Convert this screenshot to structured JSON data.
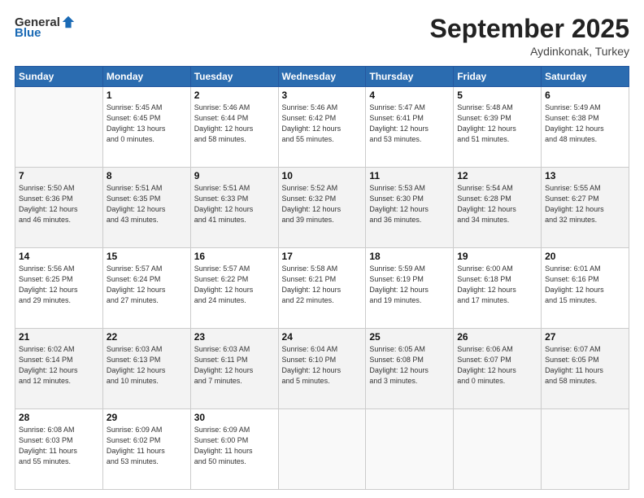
{
  "header": {
    "logo_general": "General",
    "logo_blue": "Blue",
    "month": "September 2025",
    "location": "Aydinkonak, Turkey"
  },
  "days_of_week": [
    "Sunday",
    "Monday",
    "Tuesday",
    "Wednesday",
    "Thursday",
    "Friday",
    "Saturday"
  ],
  "weeks": [
    [
      {
        "num": "",
        "info": ""
      },
      {
        "num": "1",
        "info": "Sunrise: 5:45 AM\nSunset: 6:45 PM\nDaylight: 13 hours\nand 0 minutes."
      },
      {
        "num": "2",
        "info": "Sunrise: 5:46 AM\nSunset: 6:44 PM\nDaylight: 12 hours\nand 58 minutes."
      },
      {
        "num": "3",
        "info": "Sunrise: 5:46 AM\nSunset: 6:42 PM\nDaylight: 12 hours\nand 55 minutes."
      },
      {
        "num": "4",
        "info": "Sunrise: 5:47 AM\nSunset: 6:41 PM\nDaylight: 12 hours\nand 53 minutes."
      },
      {
        "num": "5",
        "info": "Sunrise: 5:48 AM\nSunset: 6:39 PM\nDaylight: 12 hours\nand 51 minutes."
      },
      {
        "num": "6",
        "info": "Sunrise: 5:49 AM\nSunset: 6:38 PM\nDaylight: 12 hours\nand 48 minutes."
      }
    ],
    [
      {
        "num": "7",
        "info": "Sunrise: 5:50 AM\nSunset: 6:36 PM\nDaylight: 12 hours\nand 46 minutes."
      },
      {
        "num": "8",
        "info": "Sunrise: 5:51 AM\nSunset: 6:35 PM\nDaylight: 12 hours\nand 43 minutes."
      },
      {
        "num": "9",
        "info": "Sunrise: 5:51 AM\nSunset: 6:33 PM\nDaylight: 12 hours\nand 41 minutes."
      },
      {
        "num": "10",
        "info": "Sunrise: 5:52 AM\nSunset: 6:32 PM\nDaylight: 12 hours\nand 39 minutes."
      },
      {
        "num": "11",
        "info": "Sunrise: 5:53 AM\nSunset: 6:30 PM\nDaylight: 12 hours\nand 36 minutes."
      },
      {
        "num": "12",
        "info": "Sunrise: 5:54 AM\nSunset: 6:28 PM\nDaylight: 12 hours\nand 34 minutes."
      },
      {
        "num": "13",
        "info": "Sunrise: 5:55 AM\nSunset: 6:27 PM\nDaylight: 12 hours\nand 32 minutes."
      }
    ],
    [
      {
        "num": "14",
        "info": "Sunrise: 5:56 AM\nSunset: 6:25 PM\nDaylight: 12 hours\nand 29 minutes."
      },
      {
        "num": "15",
        "info": "Sunrise: 5:57 AM\nSunset: 6:24 PM\nDaylight: 12 hours\nand 27 minutes."
      },
      {
        "num": "16",
        "info": "Sunrise: 5:57 AM\nSunset: 6:22 PM\nDaylight: 12 hours\nand 24 minutes."
      },
      {
        "num": "17",
        "info": "Sunrise: 5:58 AM\nSunset: 6:21 PM\nDaylight: 12 hours\nand 22 minutes."
      },
      {
        "num": "18",
        "info": "Sunrise: 5:59 AM\nSunset: 6:19 PM\nDaylight: 12 hours\nand 19 minutes."
      },
      {
        "num": "19",
        "info": "Sunrise: 6:00 AM\nSunset: 6:18 PM\nDaylight: 12 hours\nand 17 minutes."
      },
      {
        "num": "20",
        "info": "Sunrise: 6:01 AM\nSunset: 6:16 PM\nDaylight: 12 hours\nand 15 minutes."
      }
    ],
    [
      {
        "num": "21",
        "info": "Sunrise: 6:02 AM\nSunset: 6:14 PM\nDaylight: 12 hours\nand 12 minutes."
      },
      {
        "num": "22",
        "info": "Sunrise: 6:03 AM\nSunset: 6:13 PM\nDaylight: 12 hours\nand 10 minutes."
      },
      {
        "num": "23",
        "info": "Sunrise: 6:03 AM\nSunset: 6:11 PM\nDaylight: 12 hours\nand 7 minutes."
      },
      {
        "num": "24",
        "info": "Sunrise: 6:04 AM\nSunset: 6:10 PM\nDaylight: 12 hours\nand 5 minutes."
      },
      {
        "num": "25",
        "info": "Sunrise: 6:05 AM\nSunset: 6:08 PM\nDaylight: 12 hours\nand 3 minutes."
      },
      {
        "num": "26",
        "info": "Sunrise: 6:06 AM\nSunset: 6:07 PM\nDaylight: 12 hours\nand 0 minutes."
      },
      {
        "num": "27",
        "info": "Sunrise: 6:07 AM\nSunset: 6:05 PM\nDaylight: 11 hours\nand 58 minutes."
      }
    ],
    [
      {
        "num": "28",
        "info": "Sunrise: 6:08 AM\nSunset: 6:03 PM\nDaylight: 11 hours\nand 55 minutes."
      },
      {
        "num": "29",
        "info": "Sunrise: 6:09 AM\nSunset: 6:02 PM\nDaylight: 11 hours\nand 53 minutes."
      },
      {
        "num": "30",
        "info": "Sunrise: 6:09 AM\nSunset: 6:00 PM\nDaylight: 11 hours\nand 50 minutes."
      },
      {
        "num": "",
        "info": ""
      },
      {
        "num": "",
        "info": ""
      },
      {
        "num": "",
        "info": ""
      },
      {
        "num": "",
        "info": ""
      }
    ]
  ]
}
